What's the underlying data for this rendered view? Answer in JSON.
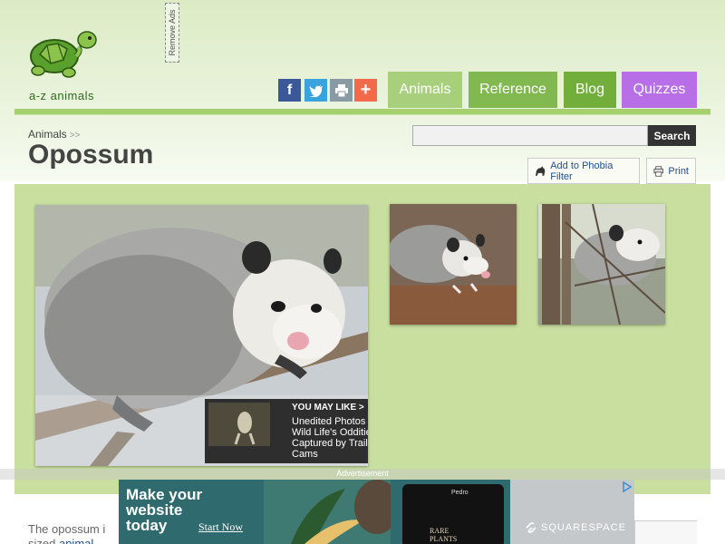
{
  "site": {
    "logo_text": "a-z animals",
    "remove_ads": "Remove Ads"
  },
  "share": {
    "facebook": "f",
    "twitter": "t",
    "print": "print-icon",
    "plus": "+"
  },
  "nav": {
    "animals": "Animals",
    "reference": "Reference",
    "blog": "Blog",
    "quizzes": "Quizzes"
  },
  "breadcrumb": {
    "item": "Animals",
    "separator": ">>"
  },
  "page": {
    "title": "Opossum"
  },
  "search": {
    "value": "",
    "button": "Search"
  },
  "tools": {
    "phobia": "Add to Phobia Filter",
    "print": "Print"
  },
  "you_may_like": {
    "heading": "YOU MAY LIKE",
    "chevron": ">",
    "text": "Unedited Photos\nWild Life's Oddities\nCaptured by Trail\nCams"
  },
  "ad": {
    "label": "Advertisement",
    "headline": "Make your website today",
    "cta": "Start Now",
    "phone_brand": "Pedro",
    "phone_text": "RARE\nPLANTS",
    "brand": "SQUARESPACE"
  },
  "body": {
    "line1": "The opossum i",
    "line2_prefix": "sized ",
    "line2_link": "animal"
  },
  "colors": {
    "nav_animals": "#a8cf7c",
    "nav_reference": "#82b850",
    "nav_blog": "#72ae3c",
    "nav_quizzes": "#b86ee6",
    "accent_green": "#a6cf6e"
  }
}
